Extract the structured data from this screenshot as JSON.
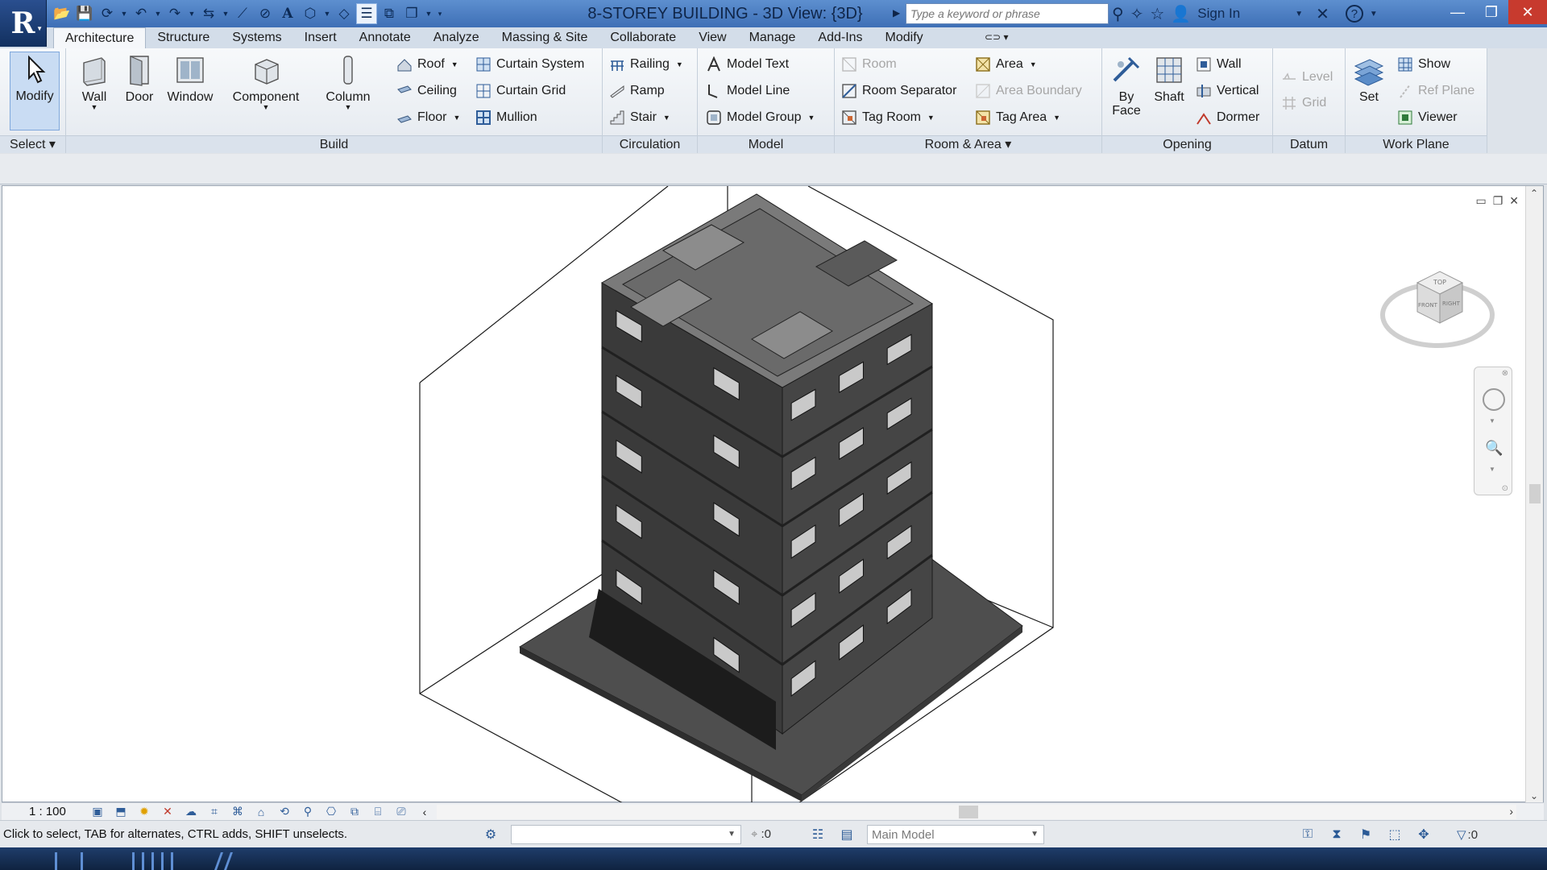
{
  "app": {
    "title": "8-STOREY BUILDING - 3D View: {3D}",
    "logo_letter": "R",
    "search_placeholder": "Type a keyword or phrase",
    "sign_in_label": "Sign In",
    "help_label": "?"
  },
  "tabs": [
    {
      "label": "Architecture",
      "active": true
    },
    {
      "label": "Structure"
    },
    {
      "label": "Systems"
    },
    {
      "label": "Insert"
    },
    {
      "label": "Annotate"
    },
    {
      "label": "Analyze"
    },
    {
      "label": "Massing & Site"
    },
    {
      "label": "Collaborate"
    },
    {
      "label": "View"
    },
    {
      "label": "Manage"
    },
    {
      "label": "Add-Ins"
    },
    {
      "label": "Modify"
    }
  ],
  "ribbon": {
    "select": {
      "title": "Select",
      "modify": "Modify"
    },
    "build": {
      "title": "Build",
      "wall": "Wall",
      "door": "Door",
      "window": "Window",
      "component": "Component",
      "column": "Column",
      "roof": "Roof",
      "ceiling": "Ceiling",
      "floor": "Floor",
      "curtain_system": "Curtain System",
      "curtain_grid": "Curtain Grid",
      "mullion": "Mullion"
    },
    "circulation": {
      "title": "Circulation",
      "railing": "Railing",
      "ramp": "Ramp",
      "stair": "Stair"
    },
    "model": {
      "title": "Model",
      "model_text": "Model Text",
      "model_line": "Model Line",
      "model_group": "Model Group"
    },
    "room_area": {
      "title": "Room & Area",
      "room": "Room",
      "room_separator": "Room Separator",
      "tag_room": "Tag Room",
      "area": "Area",
      "area_boundary": "Area Boundary",
      "tag_area": "Tag Area"
    },
    "opening": {
      "title": "Opening",
      "by_face_1": "By",
      "by_face_2": "Face",
      "shaft": "Shaft",
      "wall": "Wall",
      "vertical": "Vertical",
      "dormer": "Dormer"
    },
    "datum": {
      "title": "Datum",
      "level": "Level",
      "grid": "Grid"
    },
    "work_plane": {
      "title": "Work Plane",
      "set": "Set",
      "show": "Show",
      "ref_plane": "Ref Plane",
      "viewer": "Viewer"
    }
  },
  "viewcube": {
    "top": "TOP",
    "front": "FRONT",
    "right": "RIGHT"
  },
  "view_control": {
    "scale": "1 : 100"
  },
  "status": {
    "message": "Click to select, TAB for alternates, CTRL adds, SHIFT unselects.",
    "selection_count": ":0",
    "model": "Main Model",
    "filter_count": ":0"
  },
  "colors": {
    "title_bar": "#4a7cc2",
    "ribbon_bg": "#eef2f6",
    "building": "#3b3b3b",
    "building_top": "#707070",
    "base_slab": "#4e4e4e"
  }
}
